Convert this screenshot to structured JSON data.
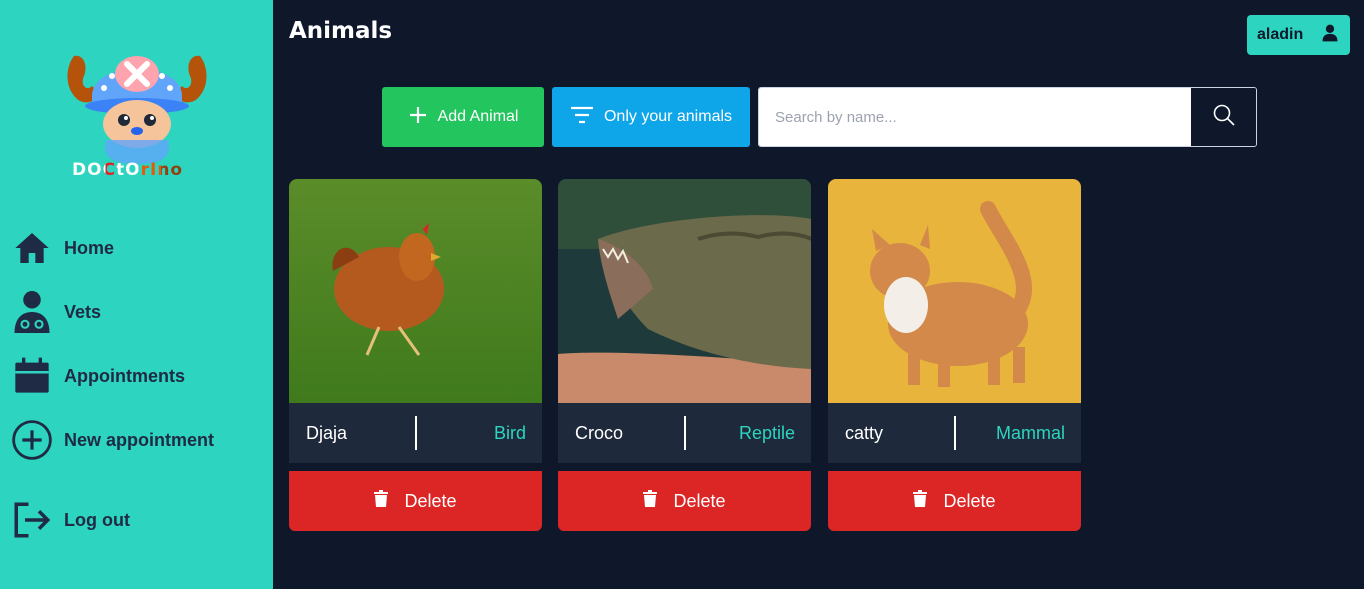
{
  "app": {
    "logo_text": "DOCtOrIno"
  },
  "sidebar": {
    "items": [
      {
        "label": "Home",
        "icon": "home-icon"
      },
      {
        "label": "Vets",
        "icon": "doctor-icon"
      },
      {
        "label": "Appointments",
        "icon": "calendar-icon"
      },
      {
        "label": "New appointment",
        "icon": "plus-circle-icon"
      },
      {
        "label": "Log out",
        "icon": "logout-icon"
      }
    ]
  },
  "header": {
    "title": "Animals",
    "user_name": "aladin"
  },
  "toolbar": {
    "add_label": "Add Animal",
    "filter_label": "Only your animals",
    "search_placeholder": "Search by name..."
  },
  "animals": [
    {
      "name": "Djaja",
      "species": "Bird",
      "image": "chicken on grass"
    },
    {
      "name": "Croco",
      "species": "Reptile",
      "image": "crocodile open mouth"
    },
    {
      "name": "catty",
      "species": "Mammal",
      "image": "orange cat"
    }
  ],
  "card": {
    "delete_label": "Delete"
  },
  "colors": {
    "sidebar": "#2dd4bf",
    "background": "#0f172a",
    "add": "#22c55e",
    "filter": "#0ea5e9",
    "delete": "#dc2626",
    "accent": "#2dd4bf"
  }
}
